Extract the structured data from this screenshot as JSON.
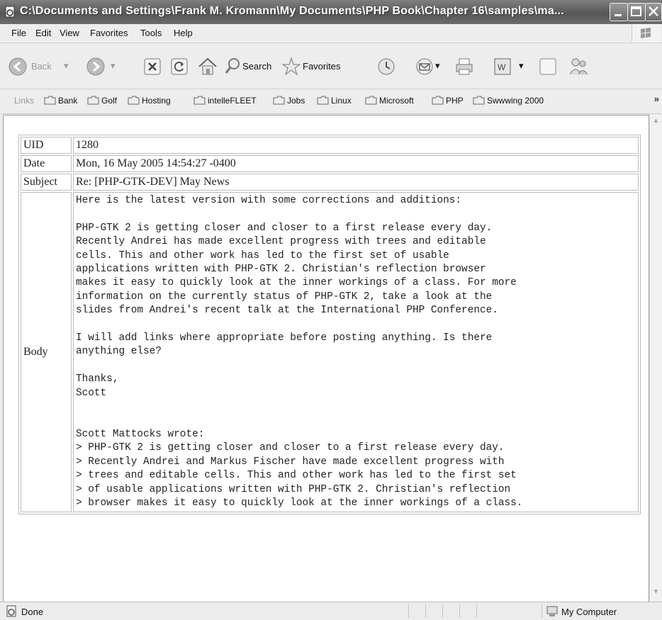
{
  "window": {
    "title": "C:\\Documents and Settings\\Frank M. Kromann\\My Documents\\PHP Book\\Chapter 16\\samples\\ma..."
  },
  "menu": [
    "File",
    "Edit",
    "View",
    "Favorites",
    "Tools",
    "Help"
  ],
  "toolbar": {
    "back_label": "Back",
    "search_label": "Search",
    "favorites_label": "Favorites"
  },
  "links": {
    "label": "Links",
    "items": [
      "Bank",
      "Golf",
      "Hosting",
      "intelleFLEET",
      "Jobs",
      "Linux",
      "Microsoft",
      "PHP",
      "Swwwing 2000"
    ],
    "overflow": "»"
  },
  "mail": {
    "uid_label": "UID",
    "uid_value": "1280",
    "date_label": "Date",
    "date_value": "Mon, 16 May 2005 14:54:27 -0400",
    "subject_label": "Subject",
    "subject_value": "Re: [PHP-GTK-DEV] May News",
    "body_label": "Body",
    "body_value": "Here is the latest version with some corrections and additions:\n\nPHP-GTK 2 is getting closer and closer to a first release every day.\nRecently Andrei has made excellent progress with trees and editable\ncells. This and other work has led to the first set of usable\napplications written with PHP-GTK 2. Christian's reflection browser\nmakes it easy to quickly look at the inner workings of a class. For more\ninformation on the currently status of PHP-GTK 2, take a look at the\nslides from Andrei's recent talk at the International PHP Conference.\n\nI will add links where appropriate before posting anything. Is there\nanything else?\n\nThanks,\nScott\n\n\nScott Mattocks wrote:\n> PHP-GTK 2 is getting closer and closer to a first release every day.\n> Recently Andrei and Markus Fischer have made excellent progress with\n> trees and editable cells. This and other work has led to the first set\n> of usable applications written with PHP-GTK 2. Christian's reflection\n> browser makes it easy to quickly look at the inner workings of a class.\n"
  },
  "status": {
    "text": "Done",
    "zone": "My Computer"
  }
}
